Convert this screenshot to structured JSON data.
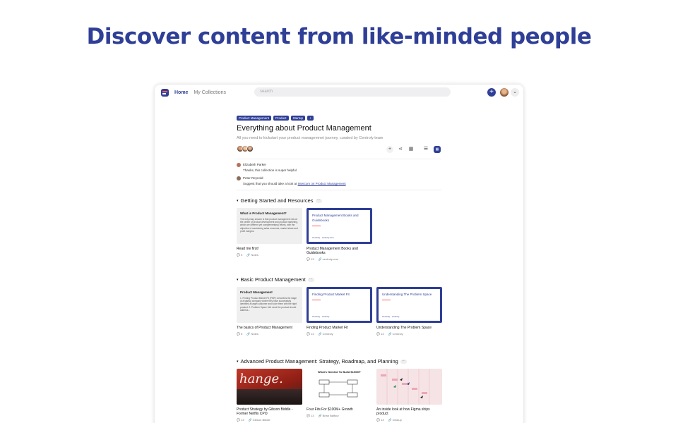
{
  "hero": {
    "title": "Discover content from like-minded people"
  },
  "topbar": {
    "nav": [
      "Home",
      "My Collections"
    ],
    "search_placeholder": "search",
    "add_label": "+",
    "chevron": "⌄"
  },
  "collection": {
    "tags": [
      "Product Management",
      "Product",
      "Startup",
      "+"
    ],
    "title": "Everything about Product Management",
    "subtitle": "All you need to kickstart your product managemnet journey, curated by Centroly team",
    "comments": [
      {
        "name": "Elizabeth Parker",
        "text": "Thanks, this collection is super helpful"
      },
      {
        "name": "Peter Reynold",
        "text": "Suggest that you should take a look at ",
        "link": "Intercom on Product Management"
      }
    ]
  },
  "sections": [
    {
      "title": "Getting Started and Resources",
      "cards": [
        {
          "kind": "note",
          "thumb_title": "What is Product Management?",
          "thumb_body": "The only easy answer is that product management sits at the center of product development and product marketing, which are different yet complementary) efforts, with the objective of maximizing sales revenues, market share and profit margins.",
          "title": "Read me first!",
          "count": "5",
          "source": "Notes"
        },
        {
          "kind": "link",
          "thumb_title": "Product Management Books and Guidebooks",
          "thumb_foot": "Centroly · centroly.com",
          "title": "Product Management Books and Guidebooks",
          "count": "13",
          "source": "centroly.com"
        }
      ]
    },
    {
      "title": "Basic Product Management",
      "cards": [
        {
          "kind": "note",
          "thumb_title": "Product Management",
          "thumb_body": "1. Finding Product Market Fit (PMF): describes the stage of a startup company where they have successfully identified a target customer and solve them with the right product. 2. Problem Space: We need the product should address...",
          "title": "The basics of Product Management",
          "count": "5",
          "source": "Notes"
        },
        {
          "kind": "link",
          "thumb_title": "Finding Product Market Fit",
          "thumb_foot": "Centroly · centroly",
          "title": "Finding Product Market Fit",
          "count": "13",
          "source": "Centroly"
        },
        {
          "kind": "link",
          "thumb_title": "Understanding The Problem Space",
          "thumb_foot": "Centroly · centroly",
          "title": "Understanding The Problem Space",
          "count": "13",
          "source": "Centroly"
        }
      ]
    },
    {
      "title": "Advanced Product Management: Strategy, Roadmap, and Planning",
      "cards": [
        {
          "kind": "photo",
          "thumb_text": "hange.",
          "title": "Product Strategy by Gibson Biddle - Former Netflix CPO",
          "count": "13",
          "source": "Gibson Biddle"
        },
        {
          "kind": "diagram",
          "thumb_title": "What's Needed To Build $100M+",
          "title": "Four Fits For $100M+ Growth",
          "count": "13",
          "source": "Brian Balfour"
        },
        {
          "kind": "figma",
          "title": "An inside look at how Figma ships product",
          "count": "13",
          "source": "Clickup"
        }
      ]
    }
  ],
  "icons": {
    "comment": "💬",
    "source": "🔗",
    "arrow": "▾",
    "more": "···",
    "plus": "+",
    "share": "⋖",
    "grid": "▦",
    "list": "☰"
  }
}
